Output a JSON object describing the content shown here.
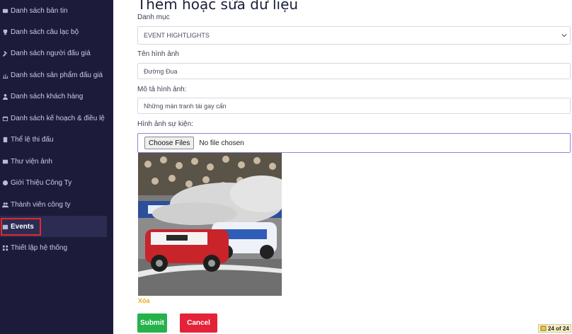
{
  "sidebar": {
    "items": [
      {
        "label": "Danh sách bản tin",
        "icon": "newspaper-icon",
        "active": false
      },
      {
        "label": "Danh sách câu lạc bộ",
        "icon": "trophy-icon",
        "active": false
      },
      {
        "label": "Danh sách người đấu giá",
        "icon": "gavel-icon",
        "active": false
      },
      {
        "label": "Danh sách sản phẩm đấu giá",
        "icon": "chart-icon",
        "active": false
      },
      {
        "label": "Danh sách khách hàng",
        "icon": "user-icon",
        "active": false
      },
      {
        "label": "Danh sách kế hoạch & điều lệ",
        "icon": "calendar-icon",
        "active": false
      },
      {
        "label": "Thể lệ thi đấu",
        "icon": "rules-icon",
        "active": false
      },
      {
        "label": "Thư viện ảnh",
        "icon": "image-icon",
        "active": false
      },
      {
        "label": "Giới Thiệu Công Ty",
        "icon": "info-icon",
        "active": false
      },
      {
        "label": "Thành viên công ty",
        "icon": "users-icon",
        "active": false
      },
      {
        "label": "Events",
        "icon": "event-icon",
        "active": true
      },
      {
        "label": "Thiết lập hệ thống",
        "icon": "settings-icon",
        "active": false
      }
    ]
  },
  "form": {
    "title": "Thêm hoặc sửa dữ liệu",
    "category_label": "Danh mục",
    "category_value": "EVENT HIGHTLIGHTS",
    "image_name_label": "Tên hình ảnh",
    "image_name_value": "Đường Đua",
    "description_label": "Mô tả hình ảnh:",
    "description_value": "Những màn tranh tài gay cấn",
    "event_image_label": "Hình ảnh sự kiện:",
    "choose_files_label": "Choose Files",
    "file_status": "No file chosen",
    "delete_link": "Xóa",
    "submit_label": "Submit",
    "cancel_label": "Cancel"
  },
  "page_badge": "24 of 24",
  "colors": {
    "sidebar_bg": "#1d1b3a",
    "active_highlight": "#e22a2a",
    "submit": "#26b24a",
    "cancel": "#e42238",
    "delete_link": "#f0a81a"
  }
}
